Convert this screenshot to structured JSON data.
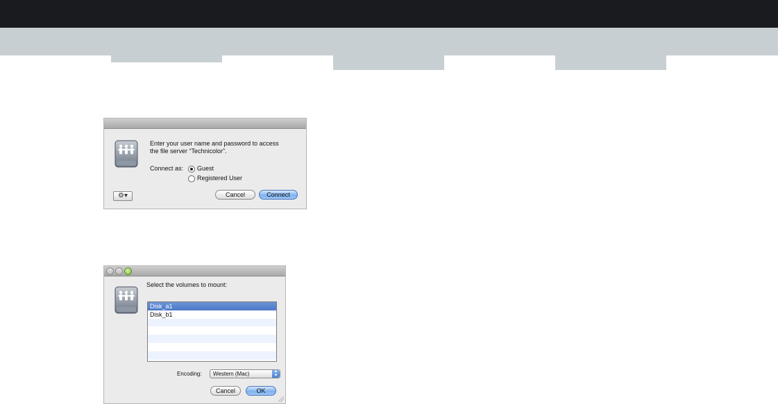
{
  "login_dialog": {
    "message_line1": "Enter your user name and password to access",
    "message_line2": "the file server “Technicolor”.",
    "connect_as_label": "Connect as:",
    "options": [
      {
        "label": "Guest",
        "selected": true
      },
      {
        "label": "Registered User",
        "selected": false
      }
    ],
    "action_icon": "gear-icon",
    "cancel_label": "Cancel",
    "connect_label": "Connect"
  },
  "volumes_dialog": {
    "prompt": "Select the volumes to mount:",
    "volumes": [
      {
        "name": "Disk_a1",
        "selected": true
      },
      {
        "name": "Disk_b1",
        "selected": false
      }
    ],
    "encoding_label": "Encoding:",
    "encoding_value": "Western (Mac)",
    "cancel_label": "Cancel",
    "ok_label": "OK"
  },
  "colors": {
    "top_bar": "#1a1b1f",
    "band": "#c8cfd2",
    "accent": "#7fb2ef"
  }
}
